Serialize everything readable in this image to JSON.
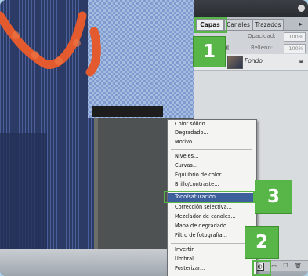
{
  "colors": {
    "accent_green": "#58b547",
    "menu_highlight": "#3d5f9c",
    "panel_bg": "#d9dcdf"
  },
  "layers_panel": {
    "tabs": [
      "Capas",
      "Canales",
      "Trazados"
    ],
    "opacity_label": "Opacidad:",
    "opacity_value": "100%",
    "fill_label": "Relleno:",
    "fill_value": "100%",
    "layer_name": "Fondo"
  },
  "menu": {
    "items": [
      "Color sólido...",
      "Degradado...",
      "Motivo...",
      "Niveles...",
      "Curvas...",
      "Equilibrio de color...",
      "Brillo/contraste...",
      "Tono/saturación...",
      "Corrección selectiva...",
      "Mezclador de canales...",
      "Mapa de degradado...",
      "Filtro de fotografía...",
      "Invertir",
      "Umbral...",
      "Posterizar..."
    ],
    "highlighted_index": 7
  },
  "callouts": {
    "one": "1",
    "two": "2",
    "three": "3"
  },
  "icons": {
    "lock": "lock-icon",
    "new_adjustment": "half-circle-icon",
    "trash": "trash-icon",
    "new_layer": "new-layer-icon"
  }
}
